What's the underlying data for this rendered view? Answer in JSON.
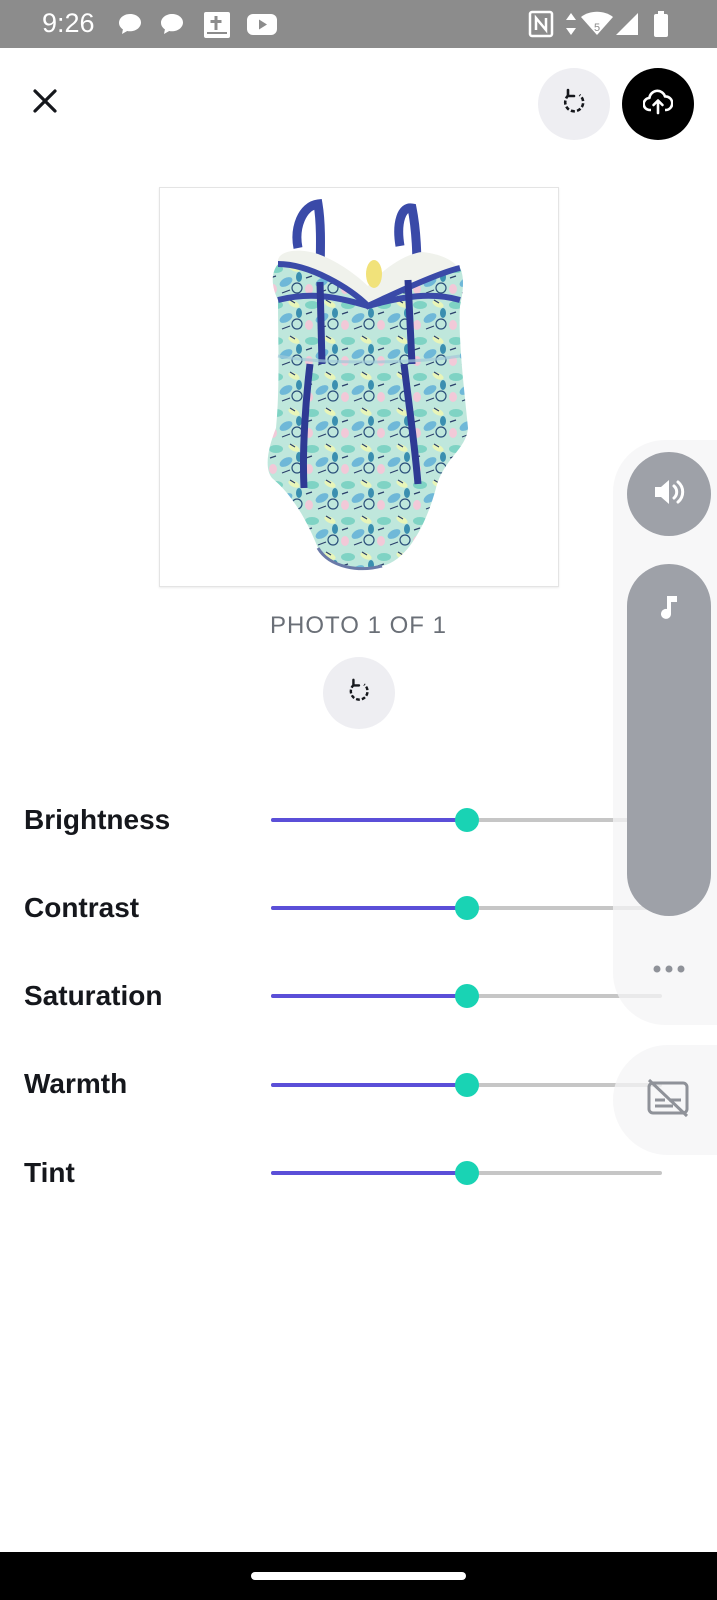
{
  "status_bar": {
    "time": "9:26",
    "notification_icons": [
      "chat-bubble-icon",
      "chat-bubble-icon",
      "bible-app-icon",
      "youtube-icon"
    ],
    "system_icons": [
      "nfc-icon",
      "data-arrows-icon",
      "wifi-icon",
      "cell-signal-icon",
      "battery-icon"
    ],
    "wifi_badge": "5"
  },
  "header": {
    "close_icon": "close-icon",
    "rotate_icon": "rotate-icon",
    "upload_icon": "cloud-upload-icon"
  },
  "photo": {
    "caption": "PHOTO 1 OF 1",
    "subject": "swimsuit"
  },
  "adjustments": [
    {
      "label": "Brightness",
      "value": 0.5
    },
    {
      "label": "Contrast",
      "value": 0.5
    },
    {
      "label": "Saturation",
      "value": 0.5
    },
    {
      "label": "Warmth",
      "value": 0.5
    },
    {
      "label": "Tint",
      "value": 0.5
    }
  ],
  "volume_overlay": {
    "speaker_icon": "volume-icon",
    "media_icon": "music-note-icon",
    "more_icon": "more-horiz-icon",
    "captions_icon": "captions-off-icon",
    "level": 1.0
  },
  "colors": {
    "accent": "#5b4fd8",
    "thumb": "#19d3b4",
    "status_bar": "#8c8c8c"
  }
}
